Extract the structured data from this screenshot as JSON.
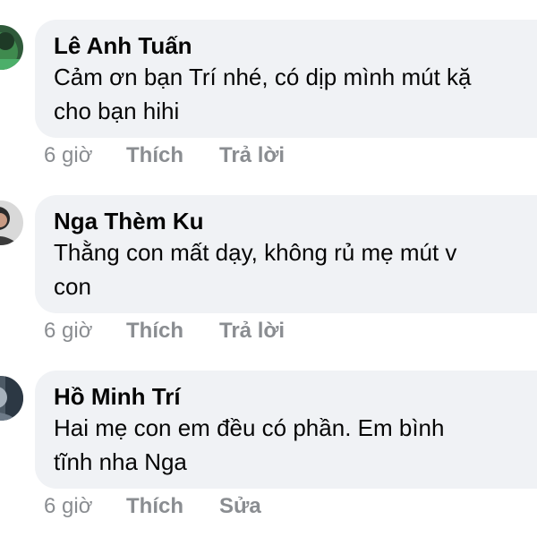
{
  "comments": [
    {
      "author": "Lê Anh Tuấn",
      "text_line1": "Cảm ơn bạn Trí nhé, có dịp mình mút kặ",
      "text_line2": "cho bạn hihi",
      "time": "6 giờ",
      "like_label": "Thích",
      "action_label": "Trả lời",
      "avatar_icon": "avatar-icon"
    },
    {
      "author": "Nga Thèm Ku",
      "text_line1": "Thằng con mất dạy, không rủ mẹ mút v",
      "text_line2": "con",
      "time": "6 giờ",
      "like_label": "Thích",
      "action_label": "Trả lời",
      "avatar_icon": "avatar-icon"
    },
    {
      "author": "Hồ Minh Trí",
      "text_line1": "Hai mẹ con em đều có phần. Em bình",
      "text_line2": "tĩnh nha Nga",
      "time": "6 giờ",
      "like_label": "Thích",
      "action_label": "Sửa",
      "avatar_icon": "avatar-icon"
    }
  ],
  "colors": {
    "bubble": "#f0f2f5",
    "meta": "#8a8d91",
    "text": "#050505"
  }
}
